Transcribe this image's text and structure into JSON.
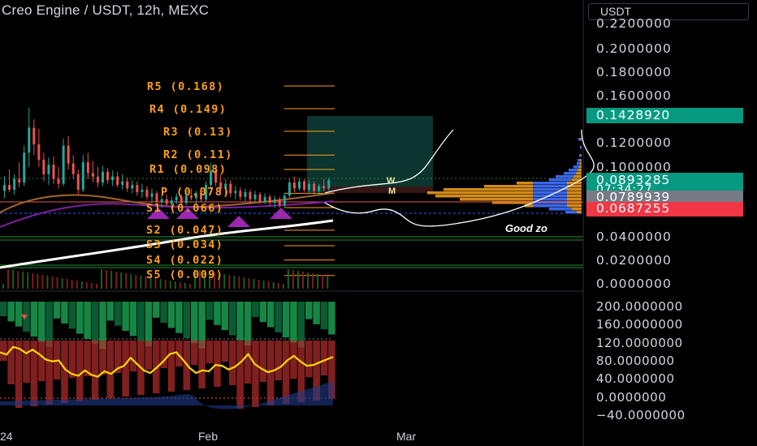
{
  "header": {
    "title": "Creo Engine / USDT, 12h, MEXC",
    "currency": "USDT"
  },
  "colors": {
    "up": "#26a69a",
    "down": "#ef5350",
    "pivot": "#ff9f1a",
    "background": "#000000"
  },
  "chart_data": [
    {
      "type": "candlestick",
      "title": "Creo Engine / USDT, 12h, MEXC",
      "y_ticks": [
        "0.2200000",
        "0.2000000",
        "0.1800000",
        "0.1600000",
        "0.1200000",
        "0.1000000",
        "0.0400000",
        "0.0200000",
        "0.0000000"
      ],
      "x_ticks": [
        "24",
        "Feb",
        "Mar"
      ],
      "ylim": [
        0,
        0.23
      ],
      "price_badges": [
        {
          "label": "0.1428920",
          "value": 0.142892,
          "color": "#089981"
        },
        {
          "label": "0.0893285",
          "value": 0.0893285,
          "color": "#089981",
          "sub": "07:34:27"
        },
        {
          "label": "0.0789939",
          "value": 0.0789939,
          "color": "#787b86"
        },
        {
          "label": "0.0687255",
          "value": 0.0687255,
          "color": "#f23645"
        }
      ],
      "pivots": [
        {
          "label": "R5 (0.168)",
          "value": 0.168
        },
        {
          "label": "R4 (0.149)",
          "value": 0.149
        },
        {
          "label": "R3 (0.13)",
          "value": 0.13
        },
        {
          "label": "R2 (0.11)",
          "value": 0.11
        },
        {
          "label": "R1 (0.098)",
          "value": 0.098
        },
        {
          "label": "P (0.078)",
          "value": 0.078
        },
        {
          "label": "S1 (0.066)",
          "value": 0.066
        },
        {
          "label": "S2 (0.047)",
          "value": 0.047
        },
        {
          "label": "S3 (0.034)",
          "value": 0.034
        },
        {
          "label": "S4 (0.022)",
          "value": 0.022
        },
        {
          "label": "S5 (0.009)",
          "value": 0.009
        }
      ],
      "annotations": {
        "good_zone": "Good zo",
        "w": "W",
        "m": "M"
      },
      "candles_ohlc": [
        [
          0.08,
          0.092,
          0.074,
          0.085
        ],
        [
          0.085,
          0.098,
          0.079,
          0.081
        ],
        [
          0.081,
          0.094,
          0.077,
          0.09
        ],
        [
          0.09,
          0.104,
          0.083,
          0.087
        ],
        [
          0.087,
          0.118,
          0.084,
          0.112
        ],
        [
          0.112,
          0.15,
          0.1,
          0.133
        ],
        [
          0.133,
          0.14,
          0.11,
          0.119
        ],
        [
          0.119,
          0.132,
          0.1,
          0.106
        ],
        [
          0.106,
          0.112,
          0.088,
          0.094
        ],
        [
          0.094,
          0.108,
          0.085,
          0.102
        ],
        [
          0.102,
          0.109,
          0.086,
          0.09
        ],
        [
          0.09,
          0.1,
          0.082,
          0.086
        ],
        [
          0.086,
          0.124,
          0.084,
          0.118
        ],
        [
          0.118,
          0.126,
          0.098,
          0.103
        ],
        [
          0.103,
          0.11,
          0.09,
          0.094
        ],
        [
          0.094,
          0.098,
          0.077,
          0.081
        ],
        [
          0.081,
          0.11,
          0.079,
          0.104
        ],
        [
          0.104,
          0.112,
          0.09,
          0.095
        ],
        [
          0.095,
          0.105,
          0.087,
          0.092
        ],
        [
          0.092,
          0.1,
          0.083,
          0.087
        ],
        [
          0.087,
          0.101,
          0.084,
          0.096
        ],
        [
          0.096,
          0.099,
          0.086,
          0.089
        ],
        [
          0.089,
          0.097,
          0.084,
          0.092
        ],
        [
          0.092,
          0.096,
          0.083,
          0.085
        ],
        [
          0.085,
          0.094,
          0.081,
          0.088
        ],
        [
          0.088,
          0.091,
          0.079,
          0.082
        ],
        [
          0.082,
          0.089,
          0.078,
          0.085
        ],
        [
          0.085,
          0.088,
          0.076,
          0.079
        ],
        [
          0.079,
          0.086,
          0.074,
          0.081
        ],
        [
          0.081,
          0.084,
          0.073,
          0.075
        ],
        [
          0.075,
          0.082,
          0.07,
          0.078
        ],
        [
          0.078,
          0.08,
          0.068,
          0.071
        ],
        [
          0.071,
          0.076,
          0.066,
          0.073
        ],
        [
          0.073,
          0.077,
          0.067,
          0.069
        ],
        [
          0.069,
          0.075,
          0.065,
          0.072
        ],
        [
          0.072,
          0.078,
          0.069,
          0.075
        ],
        [
          0.075,
          0.077,
          0.068,
          0.07
        ],
        [
          0.07,
          0.079,
          0.068,
          0.076
        ],
        [
          0.076,
          0.082,
          0.072,
          0.074
        ],
        [
          0.074,
          0.08,
          0.069,
          0.078
        ],
        [
          0.078,
          0.083,
          0.071,
          0.073
        ],
        [
          0.073,
          0.088,
          0.071,
          0.085
        ],
        [
          0.085,
          0.103,
          0.082,
          0.097
        ],
        [
          0.097,
          0.1,
          0.084,
          0.087
        ],
        [
          0.087,
          0.094,
          0.079,
          0.082
        ],
        [
          0.082,
          0.09,
          0.077,
          0.086
        ],
        [
          0.086,
          0.089,
          0.075,
          0.078
        ],
        [
          0.078,
          0.084,
          0.073,
          0.08
        ],
        [
          0.08,
          0.083,
          0.072,
          0.075
        ],
        [
          0.075,
          0.082,
          0.071,
          0.079
        ],
        [
          0.079,
          0.081,
          0.07,
          0.073
        ],
        [
          0.073,
          0.08,
          0.07,
          0.077
        ],
        [
          0.077,
          0.079,
          0.069,
          0.071
        ],
        [
          0.071,
          0.078,
          0.069,
          0.075
        ],
        [
          0.075,
          0.077,
          0.067,
          0.07
        ],
        [
          0.07,
          0.076,
          0.066,
          0.073
        ],
        [
          0.073,
          0.075,
          0.066,
          0.068
        ],
        [
          0.068,
          0.078,
          0.066,
          0.076
        ],
        [
          0.076,
          0.09,
          0.074,
          0.087
        ],
        [
          0.087,
          0.092,
          0.079,
          0.082
        ],
        [
          0.082,
          0.091,
          0.08,
          0.088
        ],
        [
          0.088,
          0.09,
          0.079,
          0.081
        ],
        [
          0.081,
          0.089,
          0.078,
          0.086
        ],
        [
          0.086,
          0.088,
          0.077,
          0.08
        ],
        [
          0.08,
          0.086,
          0.076,
          0.084
        ],
        [
          0.084,
          0.09,
          0.08,
          0.082
        ],
        [
          0.082,
          0.091,
          0.08,
          0.089
        ]
      ]
    },
    {
      "type": "line",
      "name": "oscillator",
      "y_ticks": [
        "200.0000000",
        "160.0000000",
        "120.0000000",
        "80.0000000",
        "40.0000000",
        "0.0000000",
        "−40.0000000"
      ],
      "ylim": [
        -50,
        210
      ],
      "values": [
        100,
        95,
        112,
        108,
        98,
        106,
        96,
        84,
        80,
        82,
        62,
        52,
        48,
        60,
        50,
        46,
        58,
        52,
        64,
        70,
        88,
        74,
        60,
        54,
        66,
        80,
        96,
        100,
        84,
        66,
        54,
        60,
        58,
        72,
        70,
        62,
        68,
        80,
        96,
        74,
        64,
        56,
        60,
        68,
        82,
        92,
        80,
        70,
        72,
        78,
        84,
        90
      ]
    }
  ]
}
